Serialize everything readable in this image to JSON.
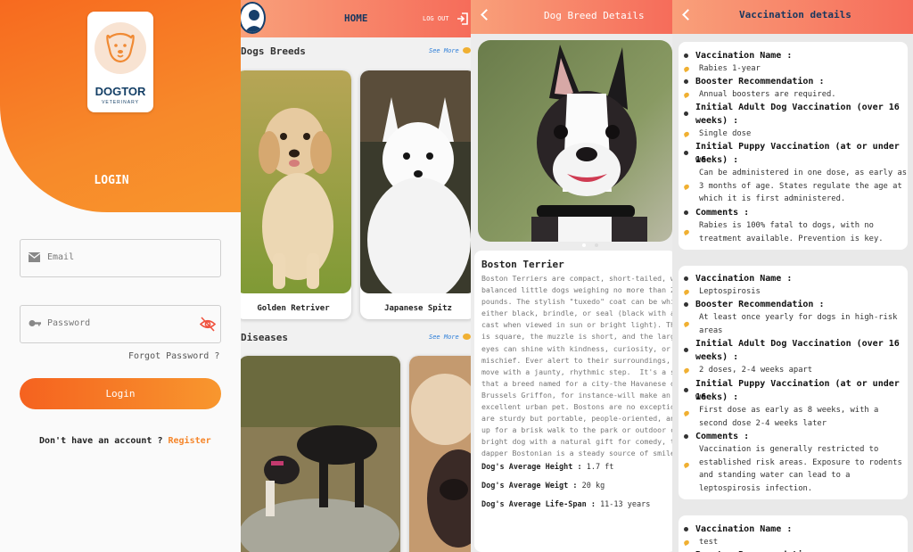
{
  "colors": {
    "accent": "#f5862b",
    "navy": "#17375f",
    "link": "#2f7fd8"
  },
  "login": {
    "logo_name": "DOGTOR",
    "logo_sub": "VETERINARY",
    "title": "LOGIN",
    "email_placeholder": "Email",
    "password_placeholder": "Password",
    "forgot": "Forgot Password ?",
    "button": "Login",
    "no_account": "Don't have an account ? ",
    "register": "Register"
  },
  "home": {
    "title": "HOME",
    "logout": "LOG OUT",
    "breeds_title": "Dogs Breeds",
    "see_more": "See More",
    "breeds": [
      {
        "label": "Golden Retriver"
      },
      {
        "label": "Japanese Spitz"
      }
    ],
    "diseases_title": "Diseases",
    "diseases_see_more": "See More"
  },
  "breed": {
    "title": "Dog Breed Details",
    "name": "Boston Terrier",
    "description": "Boston Terriers are compact, short-tailed, well\nbalanced little dogs weighing no more than 25\npounds. The stylish \"tuxedo\" coat can be white\neither black, brindle, or seal (black with a r\ncast when viewed in sun or bright light). The\nis square, the muzzle is short, and the large,\neyes can shine with kindness, curiosity, or\nmischief. Ever alert to their surroundings, Bo\nmove with a jaunty, rhythmic step.  It's a saf\nthat a breed named for a city-the Havanese or\nBrussels Griffon, for instance-will make an\nexcellent urban pet. Bostons are no exception\nare sturdy but portable, people-oriented, and\nup for a brisk walk to the park or outdoor caf\nbright dog with a natural gift for comedy, the\ndapper Bostonian is a steady source of smiles.",
    "height_label": "Dog's Average Height :",
    "height": "1.7 ft",
    "weight_label": "Dog's Average Weigt :",
    "weight": "20 kg",
    "life_label": "Dog's Average Life-Span :",
    "life": "11-13 years"
  },
  "vaccination": {
    "title": "Vaccination details",
    "labels": {
      "name": "Vaccination Name :",
      "booster": "Booster Recommendation :",
      "adult1": "Initial Adult Dog Vaccination (over 16",
      "adult2": "weeks) :",
      "puppy1": "Initial Puppy Vaccination (at or under 16",
      "puppy2": "weeks) :",
      "comments": "Comments :"
    },
    "items": [
      {
        "name": "Rabies 1-year",
        "booster": "Annual boosters are required.",
        "adult": "Single dose",
        "puppy": "Can be administered in one dose, as early as\n3 months of age. States regulate the age at\nwhich it is first administered.",
        "comments": "Rabies is 100% fatal to dogs, with no\ntreatment available. Prevention is key."
      },
      {
        "name": "Leptospirosis",
        "booster": "At least once yearly for dogs in high-risk\nareas",
        "adult": "2 doses, 2-4 weeks apart",
        "puppy": "First dose as early as 8 weeks, with a\nsecond dose 2-4 weeks later",
        "comments": "Vaccination is generally restricted to\nestablished risk areas. Exposure to rodents\nand standing water can lead to a\nleptospirosis infection."
      },
      {
        "name": "test"
      }
    ]
  }
}
